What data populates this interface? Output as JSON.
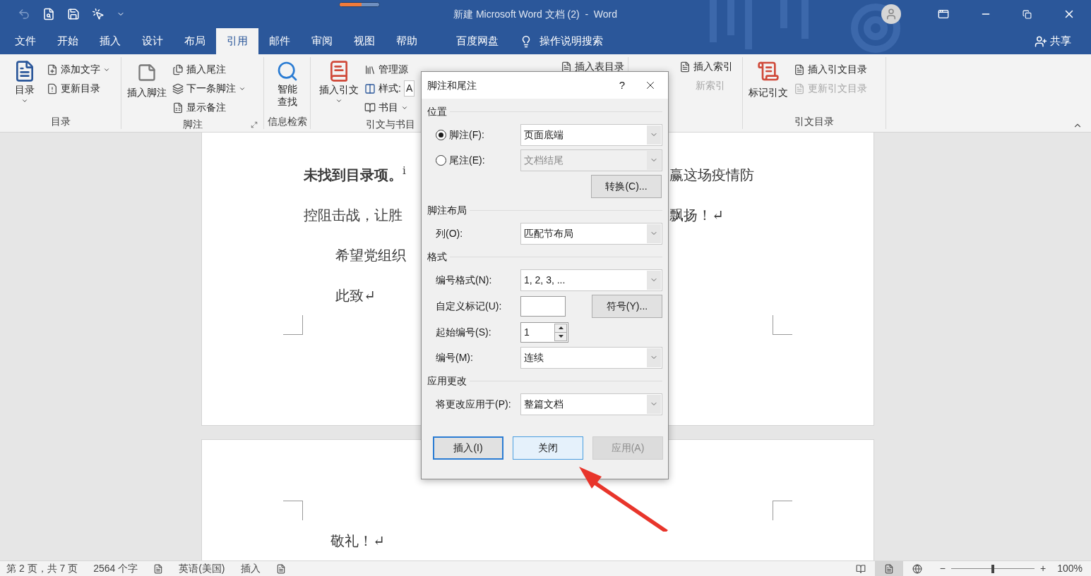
{
  "title_bar": {
    "title": "新建 Microsoft Word 文档 (2)  -  Word",
    "progress": {
      "level": 0.55
    }
  },
  "tabs": [
    {
      "label": "文件",
      "selected": false
    },
    {
      "label": "开始",
      "selected": false
    },
    {
      "label": "插入",
      "selected": false
    },
    {
      "label": "设计",
      "selected": false
    },
    {
      "label": "布局",
      "selected": false
    },
    {
      "label": "引用",
      "selected": true
    },
    {
      "label": "邮件",
      "selected": false
    },
    {
      "label": "审阅",
      "selected": false
    },
    {
      "label": "视图",
      "selected": false
    },
    {
      "label": "帮助",
      "selected": false
    },
    {
      "label": "百度网盘",
      "selected": false
    }
  ],
  "tell_me": "操作说明搜索",
  "share": "共享",
  "ribbon": {
    "toc": {
      "big": "目录",
      "items": [
        "添加文字",
        "更新目录"
      ],
      "label": "目录"
    },
    "footnotes": {
      "big": "插入脚注",
      "items": [
        "插入尾注",
        "下一条脚注",
        "显示备注"
      ],
      "label": "脚注"
    },
    "research": {
      "big": [
        "智能",
        "查找"
      ],
      "label": "信息检索"
    },
    "citations": {
      "big": "插入引文",
      "manage": "管理源",
      "style_label": "样式:",
      "style_value": "A",
      "bibliography": "书目",
      "label": "引文与书目"
    },
    "captions": {
      "items": [
        "插入表目录"
      ]
    },
    "index": {
      "items": [
        {
          "label": "插入索引",
          "disabled": false
        },
        {
          "label": "新索引",
          "disabled": true
        }
      ]
    },
    "authorities": {
      "big": "标记引文",
      "items": [
        {
          "label": "插入引文目录",
          "disabled": false
        },
        {
          "label": "更新引文目录",
          "disabled": true
        }
      ],
      "label": "引文目录"
    }
  },
  "document": {
    "page1": {
      "lines": [
        {
          "left": "**未找到目录项。**$^{i}$",
          "right": "赢这场疫情防"
        },
        {
          "left": "控阻击战，让胜",
          "right": "飘扬！↵"
        }
      ],
      "indented": [
        "希望党组织",
        "此致↵"
      ]
    },
    "page2": {
      "indented": [
        "敬礼！↵"
      ]
    }
  },
  "dialog": {
    "title": "脚注和尾注",
    "help": "?",
    "sections": [
      {
        "heading": "位置",
        "rows": [
          {
            "kind": "radio",
            "label": "脚注(F):",
            "selected": true,
            "value": "页面底端",
            "disabled": false
          },
          {
            "kind": "radio",
            "label": "尾注(E):",
            "selected": false,
            "value": "文档结尾",
            "disabled": true
          },
          {
            "kind": "button",
            "label": "转换(C)..."
          }
        ]
      },
      {
        "heading": "脚注布局",
        "rows": [
          {
            "kind": "select",
            "label": "列(O):",
            "value": "匹配节布局"
          }
        ]
      },
      {
        "heading": "格式",
        "rows": [
          {
            "kind": "select",
            "label": "编号格式(N):",
            "value": "1, 2, 3, ..."
          },
          {
            "kind": "text_button",
            "label": "自定义标记(U):",
            "button": "符号(Y)..."
          },
          {
            "kind": "spinner",
            "label": "起始编号(S):",
            "value": "1"
          },
          {
            "kind": "select",
            "label": "编号(M):",
            "value": "连续"
          }
        ]
      },
      {
        "heading": "应用更改",
        "rows": [
          {
            "kind": "select",
            "label": "将更改应用于(P):",
            "value": "整篇文档"
          }
        ]
      }
    ],
    "buttons": [
      {
        "label": "插入(I)",
        "kind": "default"
      },
      {
        "label": "关闭",
        "kind": "hover"
      },
      {
        "label": "应用(A)",
        "kind": "disabled"
      }
    ]
  },
  "status_bar": {
    "left": [
      {
        "kind": "text",
        "text": "第 2 页，共 7 页"
      },
      {
        "kind": "text",
        "text": "2564 个字"
      },
      {
        "kind": "icon"
      },
      {
        "kind": "text",
        "text": "英语(美国)"
      },
      {
        "kind": "text",
        "text": "插入"
      },
      {
        "kind": "icon"
      }
    ],
    "views": [
      {
        "selected": false
      },
      {
        "selected": true
      },
      {
        "selected": false
      }
    ],
    "zoom_out": "−",
    "zoom_in": "+",
    "zoom": {
      "level": 0.5
    },
    "zoom_text": "100%"
  }
}
